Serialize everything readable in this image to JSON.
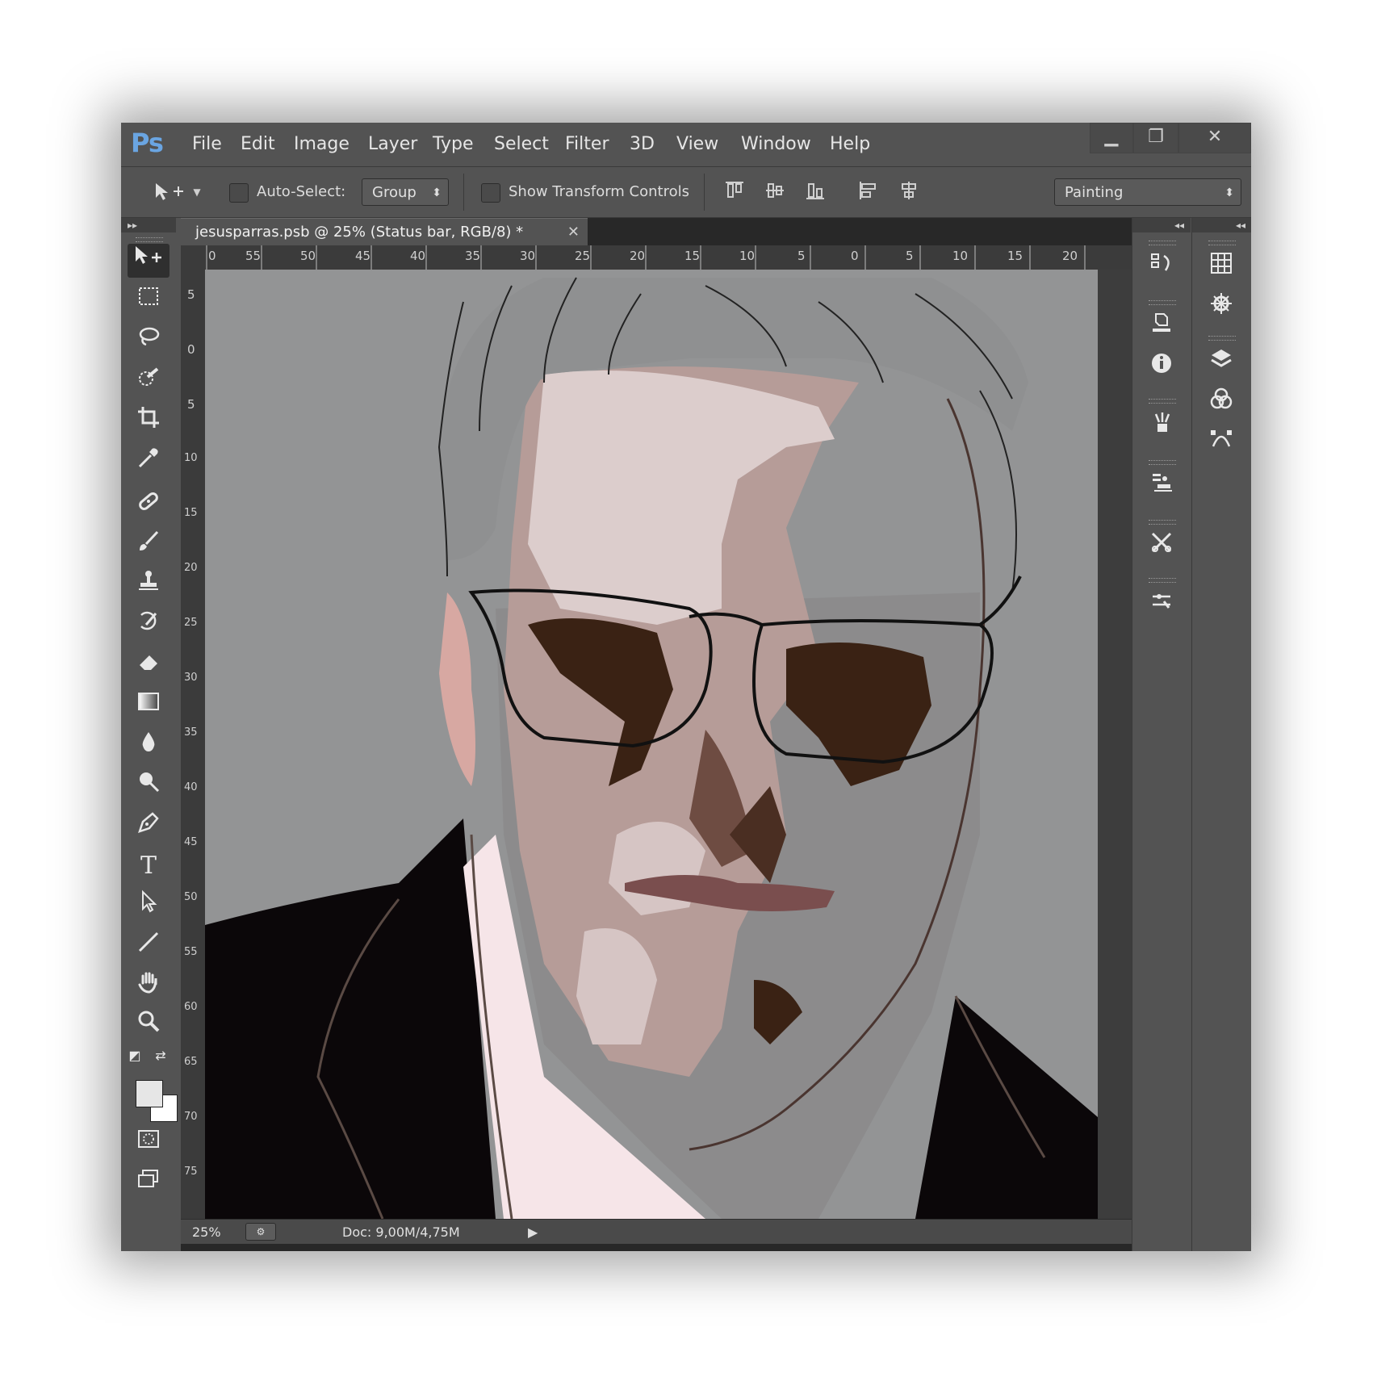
{
  "app": {
    "logo": "Ps"
  },
  "menu": [
    "File",
    "Edit",
    "Image",
    "Layer",
    "Type",
    "Select",
    "Filter",
    "3D",
    "View",
    "Window",
    "Help"
  ],
  "window_controls": {
    "minimize": "▁",
    "restore": "❐",
    "close": "✕"
  },
  "options": {
    "auto_select_label": "Auto-Select:",
    "auto_select_value": "Group",
    "transform_label": "Show Transform Controls",
    "workspace": "Painting"
  },
  "document": {
    "tab_title": "jesusparras.psb @ 25% (Status bar, RGB/8) *",
    "close": "✕"
  },
  "rulers": {
    "top": [
      "0",
      "55",
      "50",
      "45",
      "40",
      "35",
      "30",
      "25",
      "20",
      "15",
      "10",
      "5",
      "0",
      "5",
      "10",
      "15",
      "20"
    ],
    "left": [
      "5",
      "0",
      "5",
      "10",
      "15",
      "20",
      "25",
      "30",
      "35",
      "40",
      "45",
      "50",
      "55",
      "60",
      "65",
      "70",
      "75"
    ]
  },
  "status": {
    "zoom": "25%",
    "doc": "Doc: 9,00M/4,75M",
    "arrow": "▶"
  },
  "icons": {
    "move": "move-tool-icon",
    "marquee": "rect-marquee-icon",
    "lasso": "lasso-icon",
    "quick_select": "quick-select-icon",
    "crop": "crop-icon",
    "eyedropper": "eyedropper-icon"
  },
  "colors": {
    "accent": "#6aa5e2",
    "ui": "#535353",
    "canvas": "#939495"
  }
}
